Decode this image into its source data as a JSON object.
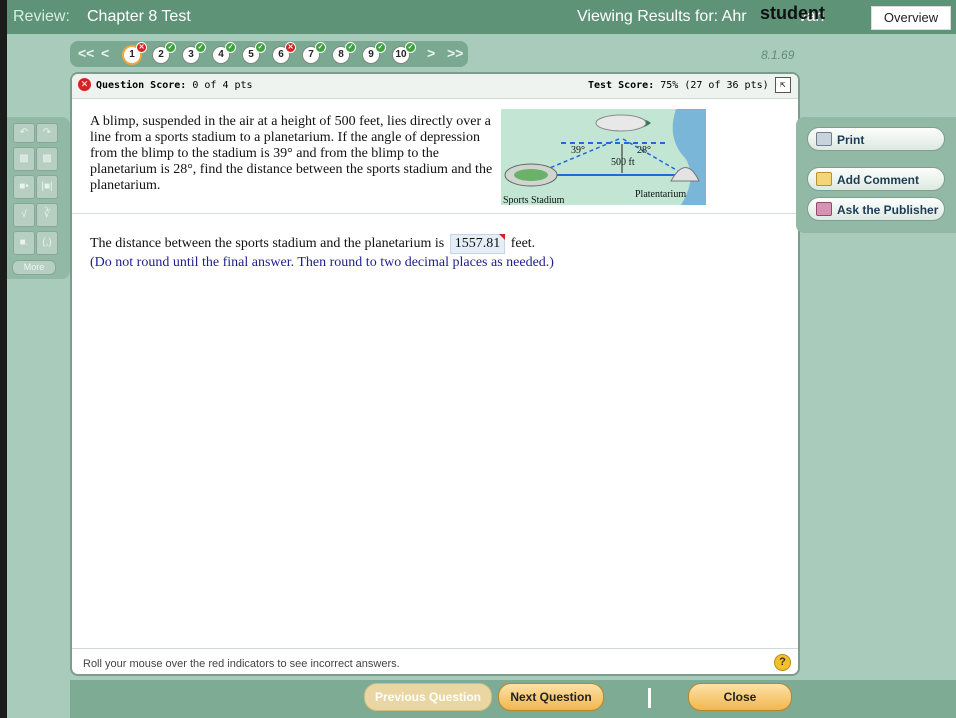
{
  "header": {
    "review_label": "Review:",
    "title": "Chapter 8 Test",
    "viewing_label": "Viewing Results for: Ahr",
    "viewing_tail": "vari",
    "student_overlay": "student",
    "overview_tab": "Overview"
  },
  "question_nav": {
    "first": "<<",
    "prev": "<",
    "next": ">",
    "last": ">>",
    "questions": [
      {
        "n": "1",
        "status": "incorrect",
        "current": true
      },
      {
        "n": "2",
        "status": "correct"
      },
      {
        "n": "3",
        "status": "correct"
      },
      {
        "n": "4",
        "status": "correct"
      },
      {
        "n": "5",
        "status": "correct"
      },
      {
        "n": "6",
        "status": "incorrect"
      },
      {
        "n": "7",
        "status": "correct"
      },
      {
        "n": "8",
        "status": "correct"
      },
      {
        "n": "9",
        "status": "correct"
      },
      {
        "n": "10",
        "status": "correct"
      }
    ],
    "version": "8.1.69"
  },
  "panel": {
    "question_score_label": "Question Score:",
    "question_score": "0 of 4 pts",
    "test_score_label": "Test Score:",
    "test_score": "75% (27 of 36 pts)",
    "question_text": "A blimp, suspended in the air at a height of 500 feet, lies directly over a line from a sports stadium to a planetarium. If the angle of depression from the blimp to the stadium is 39° and from the blimp to the planetarium is 28°, find the distance between the sports stadium and the planetarium.",
    "figure": {
      "angle_left": "39°",
      "angle_right": "28°",
      "height": "500 ft",
      "label_left": "Sports Stadium",
      "label_right": "Platentarium"
    },
    "answer_prefix": "The distance between the sports stadium and the planetarium is",
    "answer_value": "1557.81",
    "answer_suffix": "feet.",
    "answer_note": "(Do not round until the final answer. Then round to two decimal places as needed.)",
    "footer_hint": "Roll your mouse over the red indicators to see incorrect answers.",
    "help_symbol": "?"
  },
  "tools": {
    "more_label": "More"
  },
  "side_actions": {
    "print": "Print",
    "add_comment": "Add Comment",
    "ask_publisher": "Ask the Publisher"
  },
  "bottom_nav": {
    "previous": "Previous Question",
    "next": "Next Question",
    "close": "Close"
  },
  "colors": {
    "header_bg": "#5e9378",
    "frame_bg": "#a9cbbb",
    "incorrect": "#d42323",
    "correct": "#3ea23e",
    "note_text": "#1d1d8f"
  }
}
